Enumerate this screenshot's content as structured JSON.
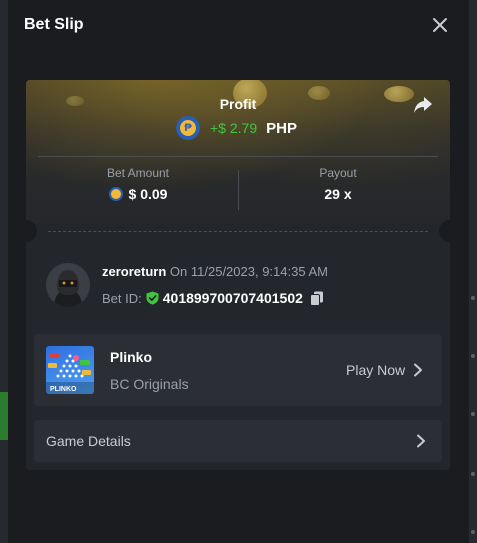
{
  "modal": {
    "title": "Bet Slip"
  },
  "profit": {
    "label": "Profit",
    "coin_symbol": "₱",
    "amount": "+$ 2.79",
    "currency": "PHP"
  },
  "stats": {
    "bet_amount_label": "Bet Amount",
    "bet_amount_value": "$ 0.09",
    "payout_label": "Payout",
    "payout_value": "29 x"
  },
  "bet": {
    "username": "zeroreturn",
    "datetime": "On 11/25/2023, 9:14:35 AM",
    "bet_id_label": "Bet ID:",
    "bet_id": "401899700707401502"
  },
  "game": {
    "name": "Plinko",
    "provider": "BC Originals",
    "play_label": "Play Now",
    "thumb_text": "PLINKO"
  },
  "details": {
    "label": "Game Details"
  },
  "colors": {
    "profit_green": "#3fc63f",
    "coin_blue": "#2a5fb0",
    "coin_gold": "#f0b93a",
    "shield_green": "#3fc63f"
  },
  "icons": [
    "close-icon",
    "share-icon",
    "peso-coin-icon",
    "shield-check-icon",
    "copy-icon",
    "chevron-right-icon"
  ]
}
